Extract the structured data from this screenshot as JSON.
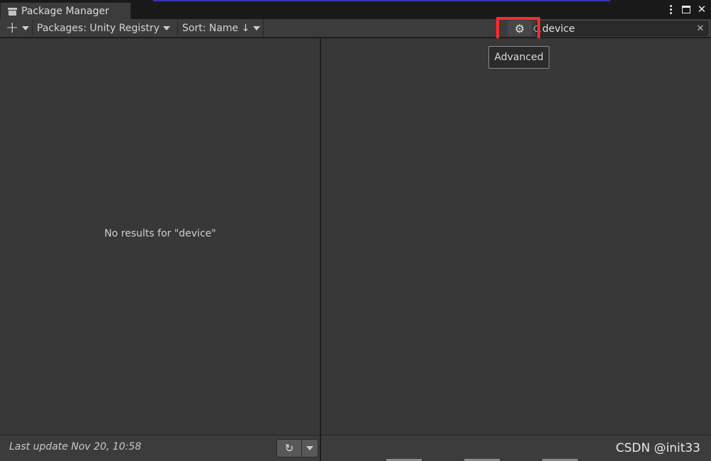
{
  "window": {
    "title": "Package Manager",
    "controls": {
      "kebab": "more-icon",
      "maximize": "maximize-icon",
      "close": "✕"
    }
  },
  "toolbar": {
    "add_icon": "+",
    "packages_filter": "Packages: Unity Registry",
    "sort": "Sort: Name ↓",
    "settings_icon": "⚙",
    "search": {
      "value": "device",
      "clear": "✕"
    }
  },
  "tooltip": {
    "text": "Advanced"
  },
  "list": {
    "empty_message": "No results for \"device\""
  },
  "footer": {
    "last_update": "Last update Nov 20, 10:58",
    "refresh_icon": "↻"
  },
  "watermark": "CSDN @init33",
  "colors": {
    "highlight": "#ff2a2a",
    "panel": "#383838",
    "toolbar": "#3c3c3c"
  }
}
